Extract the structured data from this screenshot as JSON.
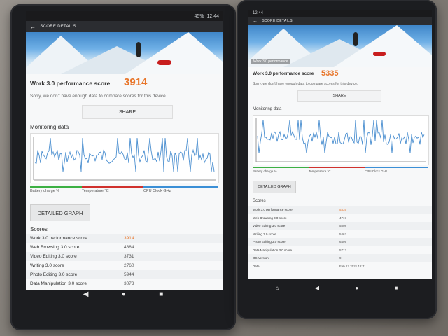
{
  "left_device": {
    "status": {
      "battery": "45%",
      "time": "12:44"
    },
    "app_title": "SCORE DETAILS",
    "score_label": "Work 3.0 performance score",
    "score_value": "3914",
    "compare_note": "Sorry, we don't have enough data to compare scores for this device.",
    "share_label": "SHARE",
    "monitoring_title": "Monitoring data",
    "legend": [
      "Battery charge %",
      "Temperature °C",
      "CPU Clock GHz"
    ],
    "detail_button": "DETAILED GRAPH",
    "scores_title": "Scores",
    "rows": [
      {
        "k": "Work 3.0 performance score",
        "v": "3914"
      },
      {
        "k": "Web Browsing 3.0 score",
        "v": "4884"
      },
      {
        "k": "Video Editing 3.0 score",
        "v": "3731"
      },
      {
        "k": "Writing 3.0 score",
        "v": "2760"
      },
      {
        "k": "Photo Editing 3.0 score",
        "v": "5944"
      },
      {
        "k": "Data Manipulation 3.0 score",
        "v": "3073"
      }
    ]
  },
  "right_device": {
    "status": {
      "time": "12:44"
    },
    "app_title": "SCORE DETAILS",
    "hero_caption": "Work 3.0 performance",
    "score_label": "Work 3.0 performance score",
    "score_value": "5335",
    "compare_note": "Sorry, we don't have enough data to compare scores for this device.",
    "share_label": "SHARE",
    "monitoring_title": "Monitoring data",
    "legend": [
      "Battery charge %",
      "Temperature °C",
      "CPU Clock GHz"
    ],
    "detail_button": "DETAILED GRAPH",
    "scores_title": "Scores",
    "rows": [
      {
        "k": "Work 3.0 performance score",
        "v": "5335"
      },
      {
        "k": "Web Browsing 3.0 score",
        "v": "4717"
      },
      {
        "k": "Video Editing 3.0 score",
        "v": "5808"
      },
      {
        "k": "Writing 3.0 score",
        "v": "5463"
      },
      {
        "k": "Photo Editing 3.0 score",
        "v": "6409"
      },
      {
        "k": "Data Manipulation 3.0 score",
        "v": "5713"
      },
      {
        "k": "OS Version",
        "v": "9"
      },
      {
        "k": "Date",
        "v": "Feb 17 2021 12:41"
      }
    ]
  },
  "colors": {
    "score_accent": "#e8762b",
    "legend_battery": "#3cb043",
    "legend_temp": "#d0312d",
    "legend_cpu": "#3b8fd6",
    "graph_line": "#4b8fd0"
  }
}
